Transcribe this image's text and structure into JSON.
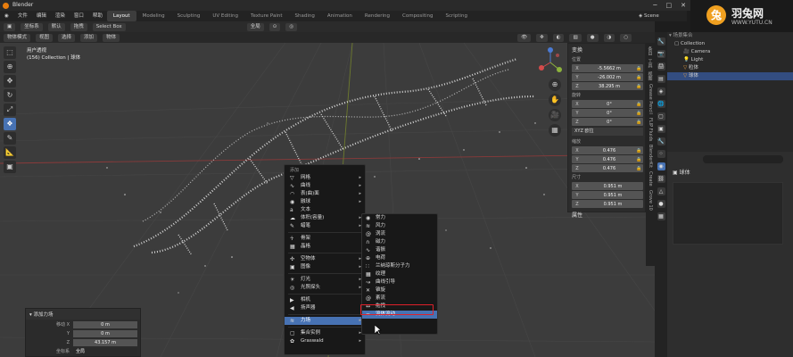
{
  "window": {
    "title": "Blender",
    "scene": "Scene"
  },
  "menubar": {
    "menus": [
      "文件",
      "编辑",
      "渲染",
      "窗口",
      "帮助"
    ],
    "workspaces": [
      "Layout",
      "Modeling",
      "Sculpting",
      "UV Editing",
      "Texture Paint",
      "Shading",
      "Animation",
      "Rendering",
      "Compositing",
      "Scripting"
    ],
    "active_workspace": "Layout"
  },
  "viewport_header": {
    "orientation_label": "坐标系",
    "orientation_value": "默认",
    "drag_label": "拖拽",
    "select_mode": "Select Box",
    "pivot": "全局",
    "mode": "物体模式",
    "view_menus": [
      "视图",
      "选择",
      "添加",
      "物体"
    ]
  },
  "viewport_info": {
    "line1": "用户透视",
    "line2": "(156) Collection | 球体"
  },
  "toolbar": {
    "tools": [
      "select-box",
      "cursor",
      "move",
      "rotate",
      "scale",
      "transform",
      "annotate",
      "measure",
      "add-cube"
    ],
    "selected_index": 5
  },
  "npanel": {
    "transform_header": "变换",
    "location_label": "位置",
    "location": [
      {
        "axis": "X",
        "value": "-5.5662 m"
      },
      {
        "axis": "Y",
        "value": "-26.002 m"
      },
      {
        "axis": "Z",
        "value": "38.295 m"
      }
    ],
    "rotation_label": "旋转",
    "rotation": [
      {
        "axis": "X",
        "value": "0°"
      },
      {
        "axis": "Y",
        "value": "0°"
      },
      {
        "axis": "Z",
        "value": "0°"
      }
    ],
    "rotation_mode": "XYZ 欧拉",
    "scale_label": "缩放",
    "scale": [
      {
        "axis": "X",
        "value": "0.476"
      },
      {
        "axis": "Y",
        "value": "0.476"
      },
      {
        "axis": "Z",
        "value": "0.476"
      }
    ],
    "dimensions_label": "尺寸",
    "dimensions": [
      {
        "axis": "X",
        "value": "0.951 m"
      },
      {
        "axis": "Y",
        "value": "0.951 m"
      },
      {
        "axis": "Z",
        "value": "0.951 m"
      }
    ],
    "properties_header": "属性"
  },
  "side_tabs": [
    "条目",
    "工具",
    "视图",
    "Grease Pencil",
    "FLIP Fluids",
    "BlenderKit",
    "Create",
    "Grove 10"
  ],
  "outliner": {
    "items": [
      {
        "label": "场景集合",
        "selected": false
      },
      {
        "label": "Collection",
        "selected": false
      },
      {
        "label": "Camera",
        "selected": false
      },
      {
        "label": "Light",
        "selected": false
      },
      {
        "label": "粒体",
        "selected": false
      },
      {
        "label": "球体",
        "selected": true
      }
    ]
  },
  "properties": {
    "object_name": "球体"
  },
  "last_operator": {
    "header": "添加力场",
    "fields": [
      {
        "key": "移动 X",
        "value": "0 m"
      },
      {
        "key": "Y",
        "value": "0 m"
      },
      {
        "key": "Z",
        "value": "43.157 m"
      },
      {
        "key": "坐标系",
        "value": "全局"
      }
    ]
  },
  "add_menu": {
    "header": "添加",
    "items": [
      {
        "label": "网格",
        "icon": "mesh-icon",
        "submenu": true
      },
      {
        "label": "曲线",
        "icon": "curve-icon",
        "submenu": true
      },
      {
        "label": "表(曲)面",
        "icon": "surface-icon",
        "submenu": true
      },
      {
        "label": "融球",
        "icon": "metaball-icon",
        "submenu": true
      },
      {
        "label": "文本",
        "icon": "text-icon",
        "submenu": false
      },
      {
        "label": "体积(容量)",
        "icon": "volume-icon",
        "submenu": true
      },
      {
        "label": "蜡笔",
        "icon": "grease-pencil-icon",
        "submenu": true
      },
      {
        "label": "骨架",
        "icon": "armature-icon",
        "submenu": false
      },
      {
        "label": "晶格",
        "icon": "lattice-icon",
        "submenu": false
      },
      {
        "label": "空物体",
        "icon": "empty-icon",
        "submenu": true
      },
      {
        "label": "图像",
        "icon": "image-icon",
        "submenu": true
      },
      {
        "label": "灯光",
        "icon": "light-icon",
        "submenu": true
      },
      {
        "label": "光照探头",
        "icon": "light-probe-icon",
        "submenu": true
      },
      {
        "label": "相机",
        "icon": "camera-icon",
        "submenu": false
      },
      {
        "label": "扬声器",
        "icon": "speaker-icon",
        "submenu": false
      },
      {
        "label": "力场",
        "icon": "force-field-icon",
        "submenu": true,
        "highlighted": true
      },
      {
        "label": "集合实例",
        "icon": "collection-icon",
        "submenu": true
      },
      {
        "label": "Graswald",
        "icon": "graswald-icon",
        "submenu": true
      }
    ]
  },
  "force_menu": {
    "items": [
      {
        "label": "常力",
        "icon": "force-icon"
      },
      {
        "label": "风力",
        "icon": "wind-icon"
      },
      {
        "label": "涡流",
        "icon": "vortex-icon"
      },
      {
        "label": "磁力",
        "icon": "magnet-icon"
      },
      {
        "label": "谐振",
        "icon": "harmonic-icon"
      },
      {
        "label": "电荷",
        "icon": "charge-icon"
      },
      {
        "label": "兰纳琼斯分子力",
        "icon": "lennard-jones-icon"
      },
      {
        "label": "纹理",
        "icon": "texture-icon"
      },
      {
        "label": "曲线引导",
        "icon": "curve-guide-icon"
      },
      {
        "label": "锥旋",
        "icon": "boid-icon"
      },
      {
        "label": "紊流",
        "icon": "turbulence-icon",
        "boxed": true
      },
      {
        "label": "拖拽",
        "icon": "drag-icon"
      },
      {
        "label": "流体流动",
        "icon": "fluid-flow-icon",
        "highlighted": true
      }
    ]
  },
  "watermark": {
    "title": "羽兔网",
    "url": "WWW.YUTU.CN"
  },
  "colors": {
    "accent": "#4772b3",
    "highlight_box": "#e0202a",
    "viewport_bg": "#3c3c3c"
  }
}
